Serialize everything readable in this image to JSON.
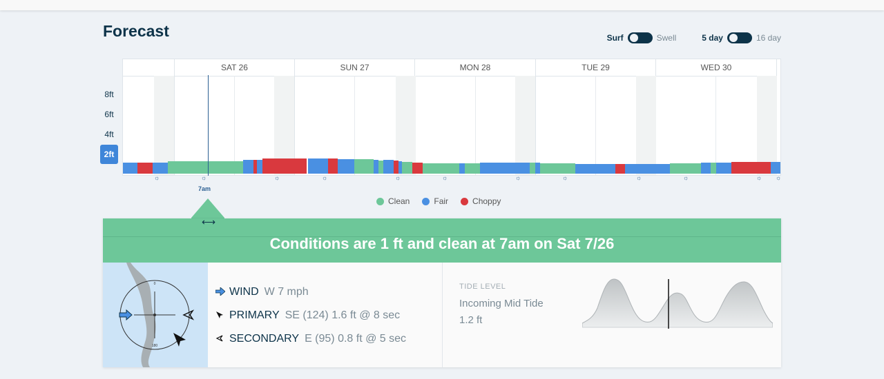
{
  "page": {
    "title": "Forecast"
  },
  "toggles": {
    "view": {
      "on_label": "Surf",
      "off_label": "Swell"
    },
    "range": {
      "on_label": "5 day",
      "off_label": "16 day"
    }
  },
  "chart": {
    "y_labels": [
      "8ft",
      "6ft",
      "4ft",
      "2ft"
    ],
    "active_y_label": "2ft",
    "days": [
      "SAT 26",
      "SUN 27",
      "MON 28",
      "TUE 29",
      "WED 30"
    ],
    "time_label": "7am",
    "legend": [
      {
        "label": "Clean",
        "color": "#6dc799"
      },
      {
        "label": "Fair",
        "color": "#4a90e2"
      },
      {
        "label": "Choppy",
        "color": "#d9393e"
      }
    ]
  },
  "conditions": {
    "headline": "Conditions are 1 ft and clean at 7am on Sat 7/26",
    "wind": {
      "label": "WIND",
      "value": "W 7 mph",
      "icon": "arrow-right-icon"
    },
    "primary": {
      "label": "PRIMARY",
      "value": "SE (124) 1.6 ft @ 8 sec",
      "icon": "arrow-pointer-icon"
    },
    "secondary": {
      "label": "SECONDARY",
      "value": "E (95) 0.8 ft @ 5 sec",
      "icon": "arrow-outline-icon"
    }
  },
  "tide": {
    "caption": "TIDE LEVEL",
    "state": "Incoming Mid Tide",
    "value": "1.2 ft"
  },
  "compass": {
    "north_label": "0",
    "south_label": "180"
  }
}
